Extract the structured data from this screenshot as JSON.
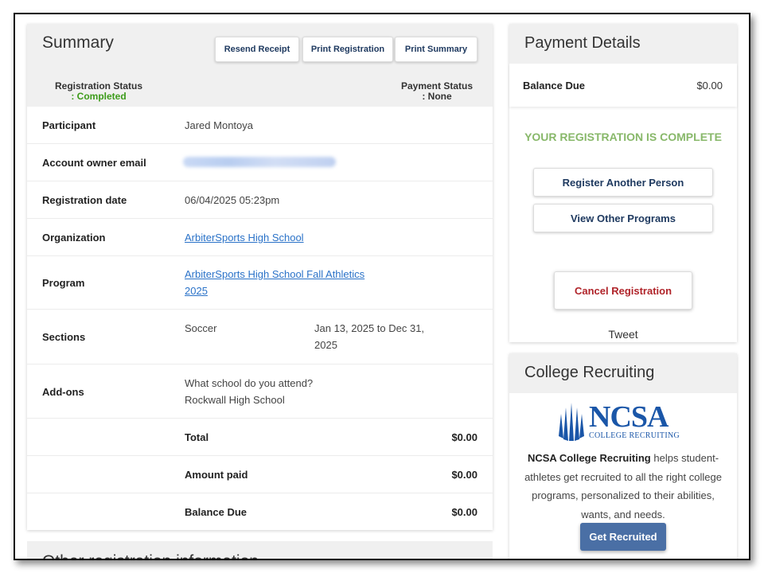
{
  "summary": {
    "title": "Summary",
    "buttons": {
      "resend": "Resend Receipt",
      "print_registration": "Print Registration",
      "print_summary": "Print Summary"
    },
    "registration_status_label": "Registration Status",
    "registration_status_value": ": Completed",
    "payment_status_label": "Payment Status",
    "payment_status_value": ": None",
    "rows": {
      "participant": {
        "label": "Participant",
        "value": "Jared Montoya"
      },
      "email": {
        "label": "Account owner email"
      },
      "date": {
        "label": "Registration date",
        "value": "06/04/2025 05:23pm"
      },
      "organization": {
        "label": "Organization",
        "value": "ArbiterSports High School"
      },
      "program": {
        "label": "Program",
        "value_line1": "ArbiterSports High School Fall Athletics",
        "value_line2": "2025"
      },
      "sections": {
        "label": "Sections",
        "name": "Soccer",
        "dates_line1": "Jan 13, 2025 to Dec 31,",
        "dates_line2": "2025"
      },
      "addons": {
        "label": "Add-ons",
        "question": "What school do you attend?",
        "answer": "Rockwall High School"
      },
      "total": {
        "label": "Total",
        "value": "$0.00"
      },
      "paid": {
        "label": "Amount paid",
        "value": "$0.00"
      },
      "balance": {
        "label": "Balance Due",
        "value": "$0.00"
      }
    }
  },
  "other": {
    "title": "Other registration information"
  },
  "payment": {
    "title": "Payment Details",
    "balance_label": "Balance Due",
    "balance_value": "$0.00",
    "complete_msg": "YOUR REGISTRATION IS COMPLETE",
    "register_another": "Register Another Person",
    "view_programs": "View Other Programs",
    "cancel": "Cancel Registration",
    "tweet": "Tweet"
  },
  "recruiting": {
    "title": "College Recruiting",
    "logo_word": "NCSA",
    "logo_sub": "COLLEGE RECRUITING",
    "text_bold": "NCSA College Recruiting",
    "text_rest": " helps student-athletes get recruited to all the right college programs, personalized to their abilities, wants, and needs.",
    "button": "Get Recruited"
  },
  "colors": {
    "status_green": "#3c9b1a",
    "link_blue": "#2a72c8",
    "cancel_red": "#b0242a",
    "complete_green": "#88b86a",
    "ncsa_blue": "#1a56a8",
    "cta_blue": "#4a6fa5"
  }
}
